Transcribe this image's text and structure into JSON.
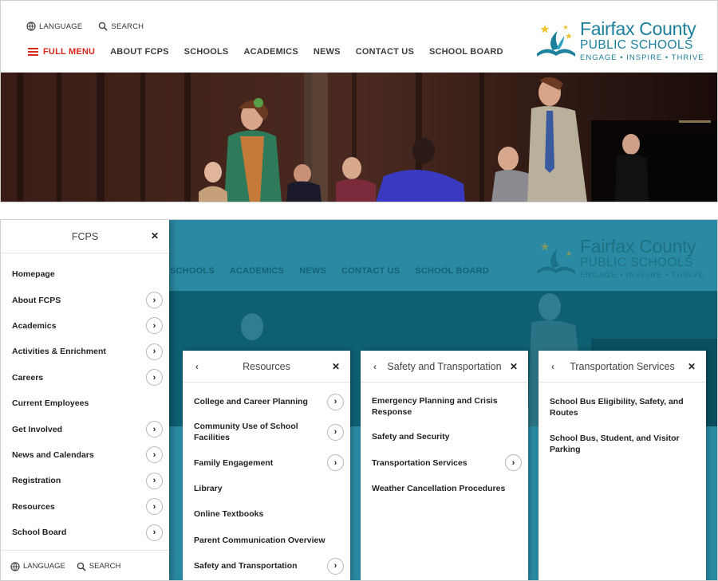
{
  "top": {
    "utility": {
      "language": "LANGUAGE",
      "search": "SEARCH"
    },
    "nav": {
      "full_menu": "FULL MENU",
      "items": [
        "ABOUT FCPS",
        "SCHOOLS",
        "ACADEMICS",
        "NEWS",
        "CONTACT US",
        "SCHOOL BOARD"
      ]
    },
    "logo": {
      "line1": "Fairfax County",
      "line2": "PUBLIC SCHOOLS",
      "line3": "ENGAGE • INSPIRE • THRIVE"
    }
  },
  "bottom": {
    "bg_nav": [
      "SCHOOLS",
      "ACADEMICS",
      "NEWS",
      "CONTACT US",
      "SCHOOL BOARD"
    ],
    "main_panel": {
      "title": "FCPS",
      "items": [
        {
          "label": "Homepage",
          "has_children": false
        },
        {
          "label": "About FCPS",
          "has_children": true
        },
        {
          "label": "Academics",
          "has_children": true
        },
        {
          "label": "Activities & Enrichment",
          "has_children": true
        },
        {
          "label": "Careers",
          "has_children": true
        },
        {
          "label": "Current Employees",
          "has_children": false
        },
        {
          "label": "Get Involved",
          "has_children": true
        },
        {
          "label": "News and Calendars",
          "has_children": true
        },
        {
          "label": "Registration",
          "has_children": true
        },
        {
          "label": "Resources",
          "has_children": true
        },
        {
          "label": "School Board",
          "has_children": true
        }
      ],
      "footer": {
        "language": "LANGUAGE",
        "search": "SEARCH"
      }
    },
    "resources_panel": {
      "title": "Resources",
      "items": [
        {
          "label": "College and Career Planning",
          "has_children": true
        },
        {
          "label": "Community Use of School Facilities",
          "has_children": true
        },
        {
          "label": "Family Engagement",
          "has_children": true
        },
        {
          "label": "Library",
          "has_children": false
        },
        {
          "label": "Online Textbooks",
          "has_children": false
        },
        {
          "label": "Parent Communication Overview",
          "has_children": false
        },
        {
          "label": "Safety and Transportation",
          "has_children": true
        }
      ]
    },
    "safety_panel": {
      "title": "Safety and Transportation",
      "items": [
        {
          "label": "Emergency Planning and Crisis Response",
          "has_children": false
        },
        {
          "label": "Safety and Security",
          "has_children": false
        },
        {
          "label": "Transportation Services",
          "has_children": true
        },
        {
          "label": "Weather Cancellation Procedures",
          "has_children": false
        }
      ]
    },
    "transport_panel": {
      "title": "Transportation Services",
      "items": [
        {
          "label": "School Bus Eligibility, Safety, and Routes",
          "has_children": false
        },
        {
          "label": "School Bus, Student, and Visitor Parking",
          "has_children": false
        }
      ]
    }
  },
  "colors": {
    "accent_red": "#d6281b",
    "brand_teal": "#1c7f9c",
    "overlay_teal": "#2a8aa3"
  },
  "icons": {
    "language": "globe-icon",
    "search": "search-icon",
    "menu": "hamburger-icon",
    "close": "close-icon",
    "back": "chevron-left-icon",
    "forward": "chevron-right-icon"
  }
}
